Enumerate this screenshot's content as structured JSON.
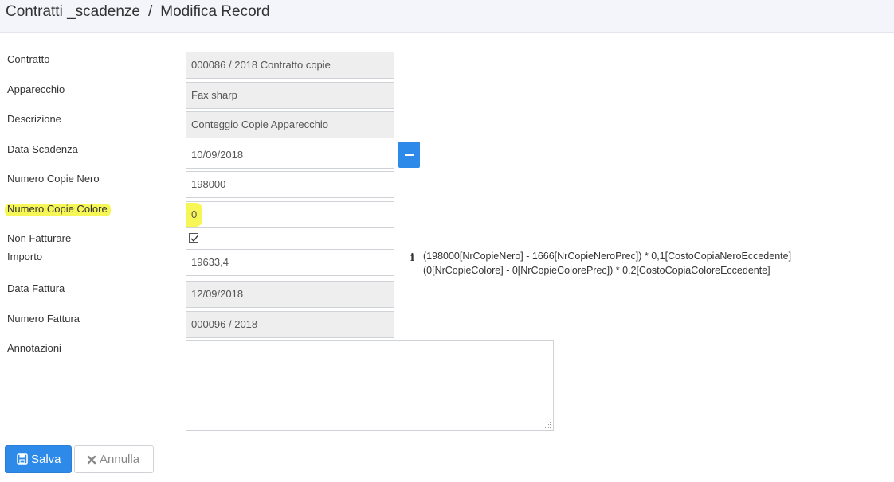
{
  "header": {
    "module": "Contratti _scadenze",
    "separator": "/",
    "page": "Modifica Record"
  },
  "form": {
    "contratto": {
      "label": "Contratto",
      "value": "000086 / 2018 Contratto copie"
    },
    "apparecchio": {
      "label": "Apparecchio",
      "value": "Fax sharp"
    },
    "descrizione": {
      "label": "Descrizione",
      "value": "Conteggio Copie Apparecchio"
    },
    "data_scadenza": {
      "label": "Data Scadenza",
      "value": "10/09/2018"
    },
    "numero_copie_nero": {
      "label": "Numero Copie Nero",
      "value": "198000"
    },
    "numero_copie_colore": {
      "label": "Numero Copie Colore",
      "value": "0"
    },
    "non_fatturare": {
      "label": "Non Fatturare",
      "checked": true
    },
    "importo": {
      "label": "Importo",
      "value": "19633,4",
      "formula_line1": "(198000[NrCopieNero] - 1666[NrCopieNeroPrec]) * 0,1[CostoCopiaNeroEccedente]",
      "formula_line2": "(0[NrCopieColore] - 0[NrCopieColorePrec]) * 0,2[CostoCopiaColoreEccedente]"
    },
    "data_fattura": {
      "label": "Data Fattura",
      "value": "12/09/2018"
    },
    "numero_fattura": {
      "label": "Numero Fattura",
      "value": "000096 / 2018"
    },
    "annotazioni": {
      "label": "Annotazioni",
      "value": ""
    }
  },
  "buttons": {
    "save_label": "Salva",
    "cancel_label": "Annulla"
  },
  "colors": {
    "primary": "#2d8ae8",
    "highlight": "#f5f53a",
    "readonly_bg": "#eeeeee"
  },
  "icons": {
    "save": "floppy-disk-icon",
    "cancel": "x-icon",
    "info": "info-icon",
    "remove_date": "minus-icon",
    "checkbox": "checkmark-icon"
  }
}
